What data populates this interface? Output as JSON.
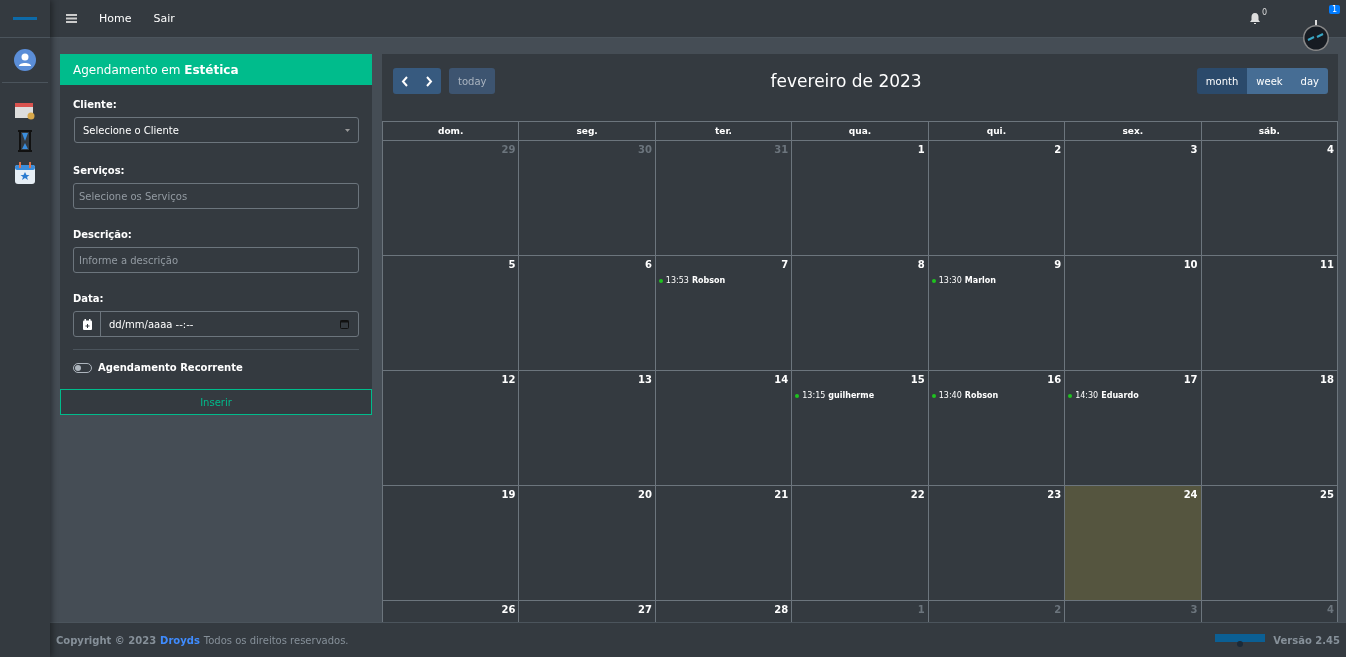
{
  "nav": {
    "links": [
      "Home",
      "Sair"
    ],
    "notifications": "0",
    "alerts": "1"
  },
  "form": {
    "title": "Agendamento em **Estética**",
    "client": {
      "label": "Cliente:",
      "value": "Selecione o Cliente"
    },
    "services": {
      "label": "Serviços:",
      "placeholder": "Selecione os Serviços"
    },
    "description": {
      "label": "Descrição:",
      "placeholder": "Informe a descrição"
    },
    "date": {
      "label": "Data:",
      "value": "dd/mm/aaaa --:--"
    },
    "recurring": {
      "label": "Agendamento Recorrente",
      "on": false
    },
    "submit": "Inserir"
  },
  "calendar": {
    "title": "fevereiro de 2023",
    "today": "today",
    "views": [
      {
        "label": "month",
        "selected": true
      },
      {
        "label": "week",
        "selected": false
      },
      {
        "label": "day",
        "selected": false
      }
    ],
    "weekdays": [
      "dom.",
      "seg.",
      "ter.",
      "qua.",
      "qui.",
      "sex.",
      "sáb."
    ],
    "weeks": [
      [
        {
          "day": "29",
          "other_month": true,
          "today": false
        },
        {
          "day": "30",
          "other_month": true,
          "today": false
        },
        {
          "day": "31",
          "other_month": true,
          "today": false
        },
        {
          "day": "1",
          "other_month": false,
          "today": false
        },
        {
          "day": "2",
          "other_month": false,
          "today": false
        },
        {
          "day": "3",
          "other_month": false,
          "today": false
        },
        {
          "day": "4",
          "other_month": false,
          "today": false
        }
      ],
      [
        {
          "day": "5",
          "other_month": false,
          "today": false
        },
        {
          "day": "6",
          "other_month": false,
          "today": false
        },
        {
          "day": "7",
          "other_month": false,
          "today": false,
          "events": [
            {
              "time": "13:53",
              "name": "Robson"
            }
          ]
        },
        {
          "day": "8",
          "other_month": false,
          "today": false
        },
        {
          "day": "9",
          "other_month": false,
          "today": false,
          "events": [
            {
              "time": "13:30",
              "name": "Marlon"
            }
          ]
        },
        {
          "day": "10",
          "other_month": false,
          "today": false
        },
        {
          "day": "11",
          "other_month": false,
          "today": false
        }
      ],
      [
        {
          "day": "12",
          "other_month": false,
          "today": false
        },
        {
          "day": "13",
          "other_month": false,
          "today": false
        },
        {
          "day": "14",
          "other_month": false,
          "today": false
        },
        {
          "day": "15",
          "other_month": false,
          "today": false,
          "events": [
            {
              "time": "13:15",
              "name": "guilherme"
            }
          ]
        },
        {
          "day": "16",
          "other_month": false,
          "today": false,
          "events": [
            {
              "time": "13:40",
              "name": "Robson"
            }
          ]
        },
        {
          "day": "17",
          "other_month": false,
          "today": false,
          "events": [
            {
              "time": "14:30",
              "name": "Eduardo"
            }
          ]
        },
        {
          "day": "18",
          "other_month": false,
          "today": false
        }
      ],
      [
        {
          "day": "19",
          "other_month": false,
          "today": false
        },
        {
          "day": "20",
          "other_month": false,
          "today": false
        },
        {
          "day": "21",
          "other_month": false,
          "today": false
        },
        {
          "day": "22",
          "other_month": false,
          "today": false
        },
        {
          "day": "23",
          "other_month": false,
          "today": false
        },
        {
          "day": "24",
          "other_month": false,
          "today": true
        },
        {
          "day": "25",
          "other_month": false,
          "today": false
        }
      ],
      [
        {
          "day": "26",
          "other_month": false,
          "today": false
        },
        {
          "day": "27",
          "other_month": false,
          "today": false
        },
        {
          "day": "28",
          "other_month": false,
          "today": false
        },
        {
          "day": "1",
          "other_month": true,
          "today": false
        },
        {
          "day": "2",
          "other_month": true,
          "today": false
        },
        {
          "day": "3",
          "other_month": true,
          "today": false
        },
        {
          "day": "4",
          "other_month": true,
          "today": false
        }
      ]
    ]
  },
  "footer": {
    "copyright": "Copyright © 2023",
    "brand": "Droyds",
    "rights": "Todos os direitos reservados.",
    "version": "Versão 2.45"
  }
}
